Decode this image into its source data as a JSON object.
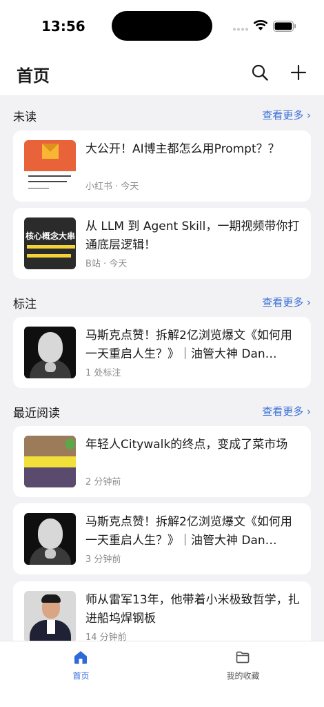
{
  "status_bar": {
    "time": "13:56"
  },
  "header": {
    "title": "首页"
  },
  "sections": {
    "unread": {
      "title": "未读",
      "see_more": "查看更多 ›"
    },
    "annotations": {
      "title": "标注",
      "see_more": "查看更多 ›"
    },
    "recent": {
      "title": "最近阅读",
      "see_more": "查看更多 ›"
    }
  },
  "unread_items": [
    {
      "title": "大公开！AI博主都怎么用Prompt？？",
      "meta": "小红书 · 今天"
    },
    {
      "title": "从 LLM 到 Agent Skill，一期视频带你打通底层逻辑！",
      "meta": "B站 · 今天"
    }
  ],
  "annotation_items": [
    {
      "title": "马斯克点赞！拆解2亿浏览爆文《如何用一天重启人生？》｜油管大神 Dan…",
      "meta": "1 处标注"
    }
  ],
  "recent_items": [
    {
      "title": "年轻人Citywalk的终点，变成了菜市场",
      "meta": "2 分钟前"
    },
    {
      "title": "马斯克点赞！拆解2亿浏览爆文《如何用一天重启人生？》｜油管大神 Dan…",
      "meta": "3 分钟前"
    },
    {
      "title": "师从雷军13年，他带着小米极致哲学，扎进船坞焊钢板",
      "meta": "14 分钟前"
    }
  ],
  "thumbnails": {
    "bili_text": "核心概念大串"
  },
  "tabs": [
    {
      "label": "首页",
      "icon": "home-icon",
      "active": true
    },
    {
      "label": "我的收藏",
      "icon": "folder-icon",
      "active": false
    }
  ],
  "colors": {
    "accent": "#3a6fd8",
    "background": "#f2f2f4",
    "card": "#ffffff",
    "meta": "#8c8c8c"
  }
}
